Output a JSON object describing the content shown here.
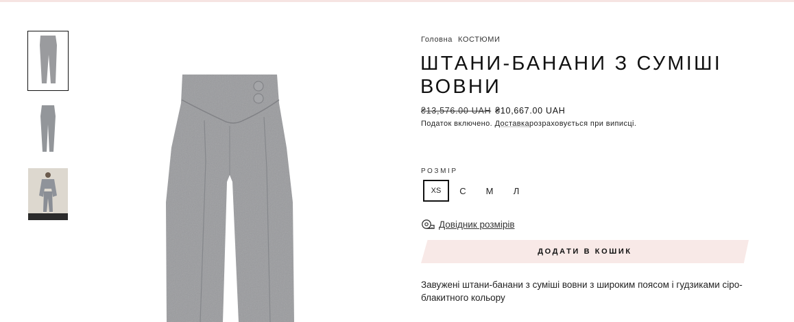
{
  "breadcrumb": {
    "home": "Головна",
    "category": "КОСТЮМИ"
  },
  "product": {
    "title": "ШТАНИ-БАНАНИ З СУМІШІ ВОВНИ",
    "old_price": "₴13,576.00 UAH",
    "new_price": "₴10,667.00 UAH",
    "tax_note": "Податок включено.",
    "shipping_link": "Доставка",
    "shipping_note": "розраховується при виписці.",
    "description": "Завужені штани-банани з суміші вовни з широким поясом і гудзиками сіро-блакитного кольору"
  },
  "size": {
    "label": "РОЗМІР",
    "options": [
      "XS",
      "С",
      "М",
      "Л"
    ],
    "selected": "XS"
  },
  "size_guide": {
    "label": "Довідник розмірів",
    "icon": "tape-measure-icon"
  },
  "cart": {
    "button_label": "ДОДАТИ В КОШИК"
  },
  "colors": {
    "accent_pink": "#f8e9e7",
    "fabric_gray": "#9a9b9e",
    "text": "#111111"
  }
}
